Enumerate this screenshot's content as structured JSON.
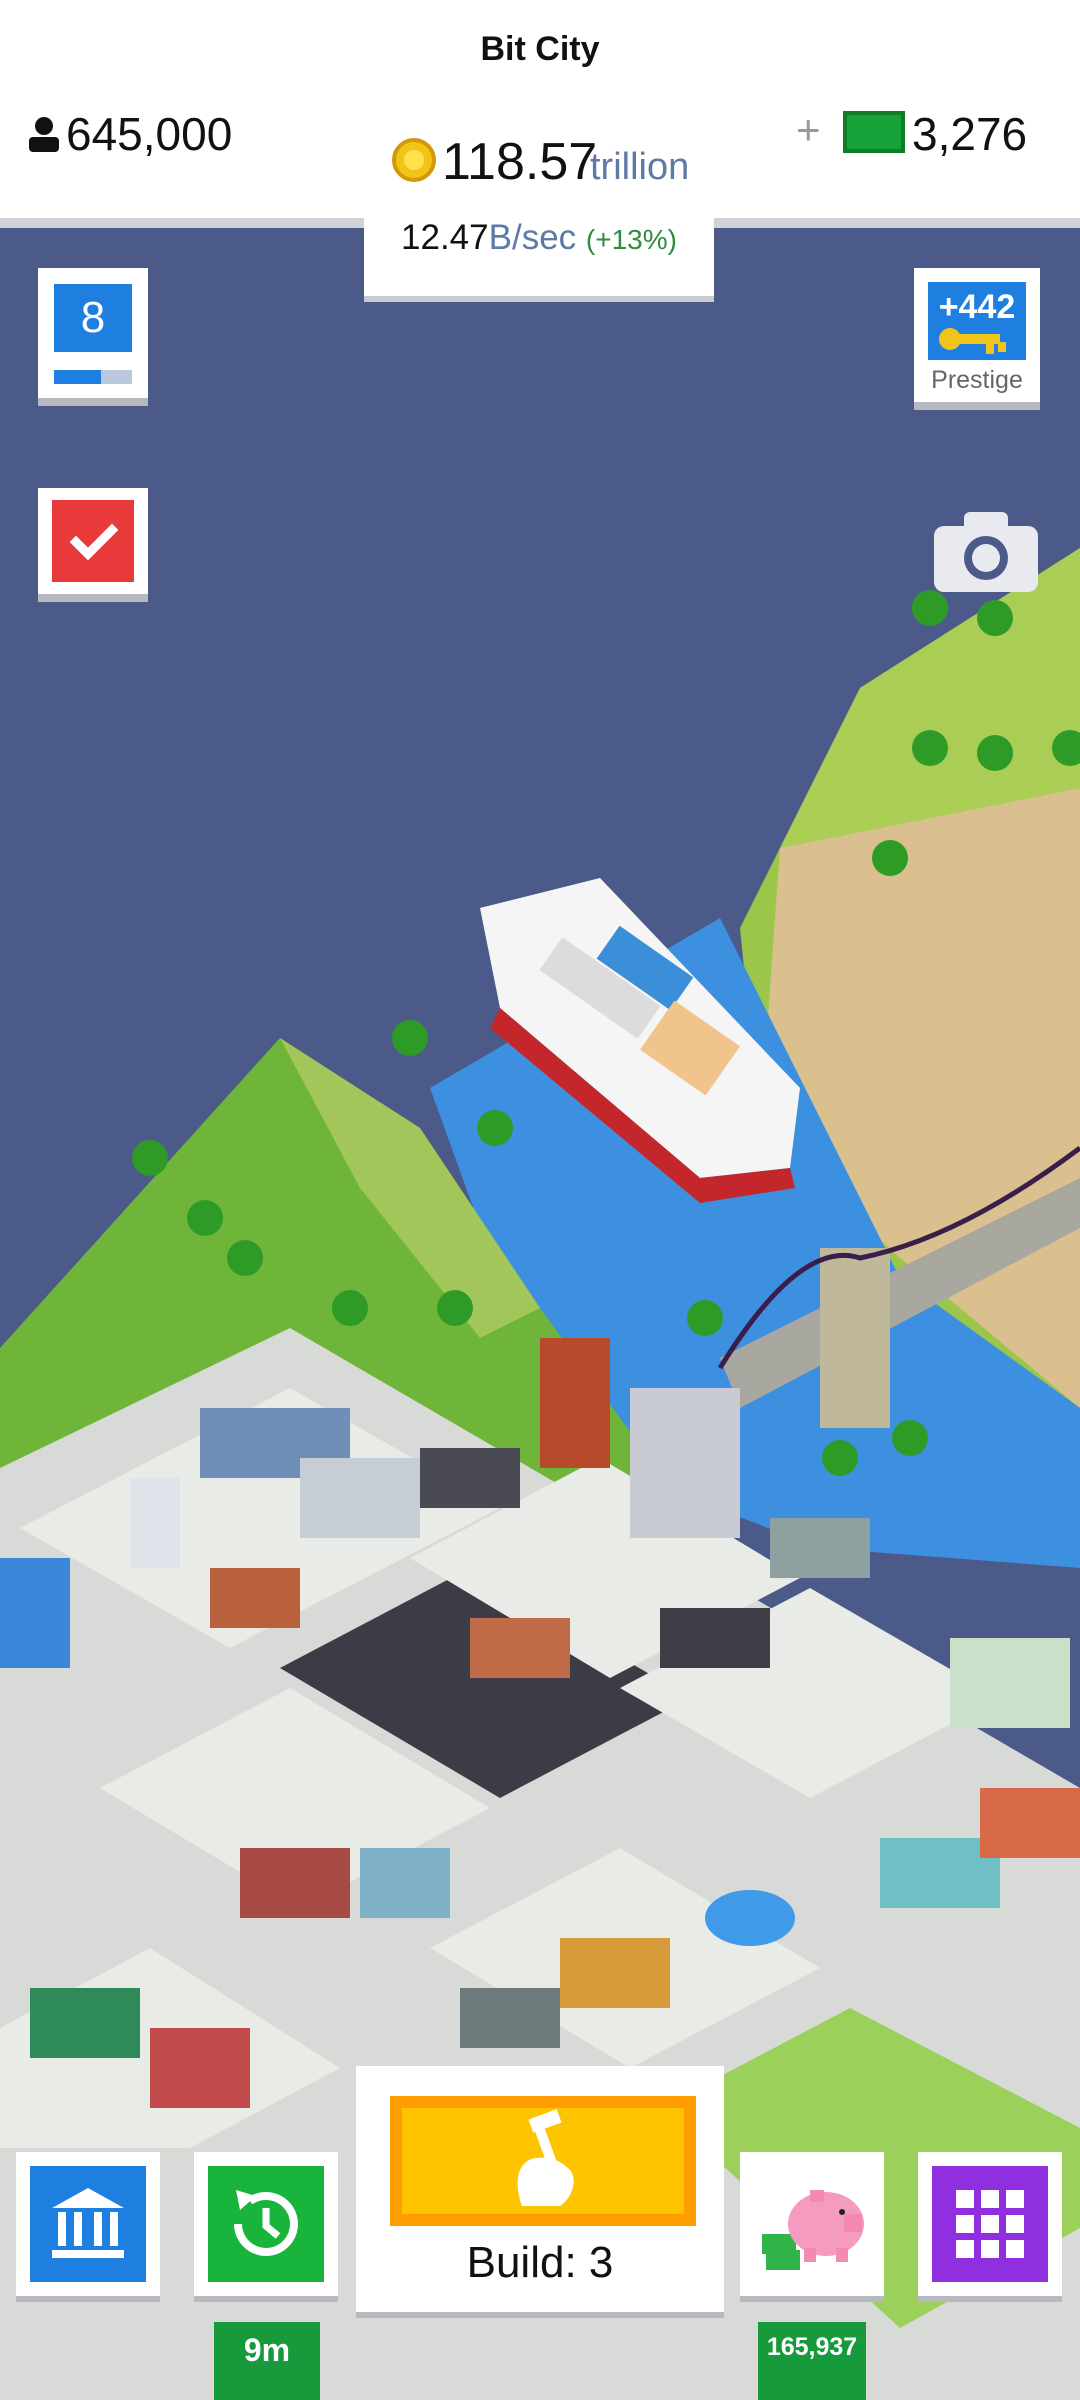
{
  "header": {
    "title": "Bit City",
    "population": "645,000",
    "coins_value": "118.57",
    "coins_unit": "trillion",
    "rate_value": "12.47",
    "rate_unit": "B/sec",
    "rate_bonus": "(+13%)",
    "plus_label": "+",
    "cash_value": "3,276"
  },
  "side": {
    "level_number": "8",
    "level_progress": 0.6,
    "prestige_value": "+442",
    "prestige_label": "Prestige"
  },
  "bottom": {
    "timer_label": "9m",
    "build_label": "Build: 3",
    "piggy_amount": "165,937"
  },
  "colors": {
    "water": "#4b5a88",
    "accent_blue": "#1f7fe0",
    "accent_green": "#19b43c",
    "accent_red": "#e83a3a",
    "accent_purple": "#8f2fe0",
    "build_yellow": "#ffc400"
  }
}
